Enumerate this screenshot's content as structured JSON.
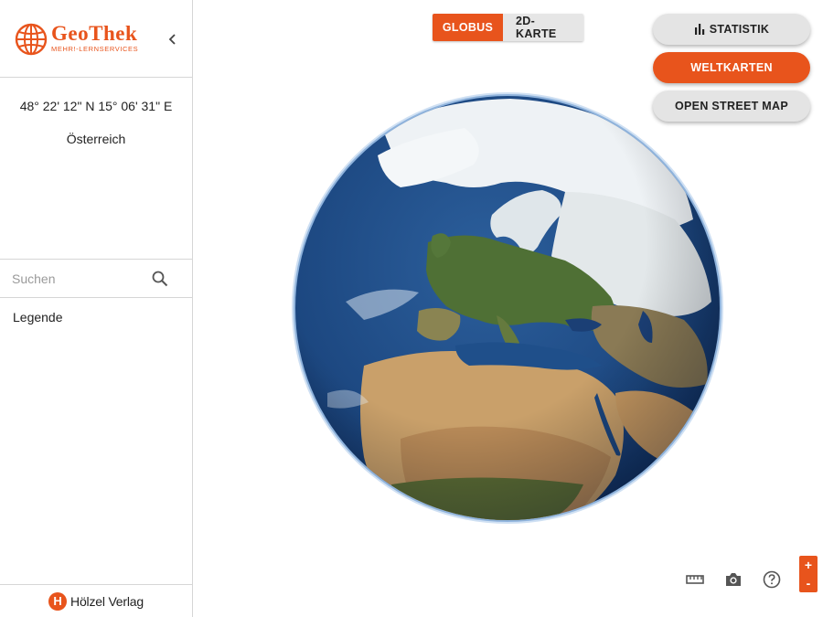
{
  "brand": {
    "name": "GeoThek",
    "tagline": "MEHR!-LERNSERVICES",
    "accent_color": "#e8541c",
    "logo_icon": "globe-grid-icon"
  },
  "sidebar": {
    "collapse_icon": "chevron-left-icon",
    "coordinates": "48° 22' 12\" N 15° 06' 31\" E",
    "country": "Österreich",
    "search": {
      "placeholder": "Suchen",
      "value": "",
      "icon": "search-icon"
    },
    "legend_label": "Legende",
    "footer": {
      "logo_letter": "H",
      "publisher": "Hölzel Verlag"
    }
  },
  "view_toggle": {
    "options": [
      {
        "label": "GLOBUS",
        "active": true
      },
      {
        "label": "2D-KARTE",
        "active": false
      }
    ]
  },
  "map_buttons": {
    "statistik": {
      "label": "STATISTIK",
      "icon": "bar-chart-icon"
    },
    "weltkarten": {
      "label": "WELTKARTEN"
    },
    "osm": {
      "label": "OPEN STREET MAP"
    }
  },
  "tools": {
    "ruler_icon": "ruler-icon",
    "camera_icon": "camera-icon",
    "help_icon": "help-icon",
    "zoom_in": "+",
    "zoom_out": "-"
  },
  "colors": {
    "accent": "#e8541c",
    "button_grey": "#e4e4e4",
    "ocean": "#1f4f8a",
    "land": "#4a6b32",
    "desert": "#c9a06a",
    "ice": "#eef2f5"
  }
}
